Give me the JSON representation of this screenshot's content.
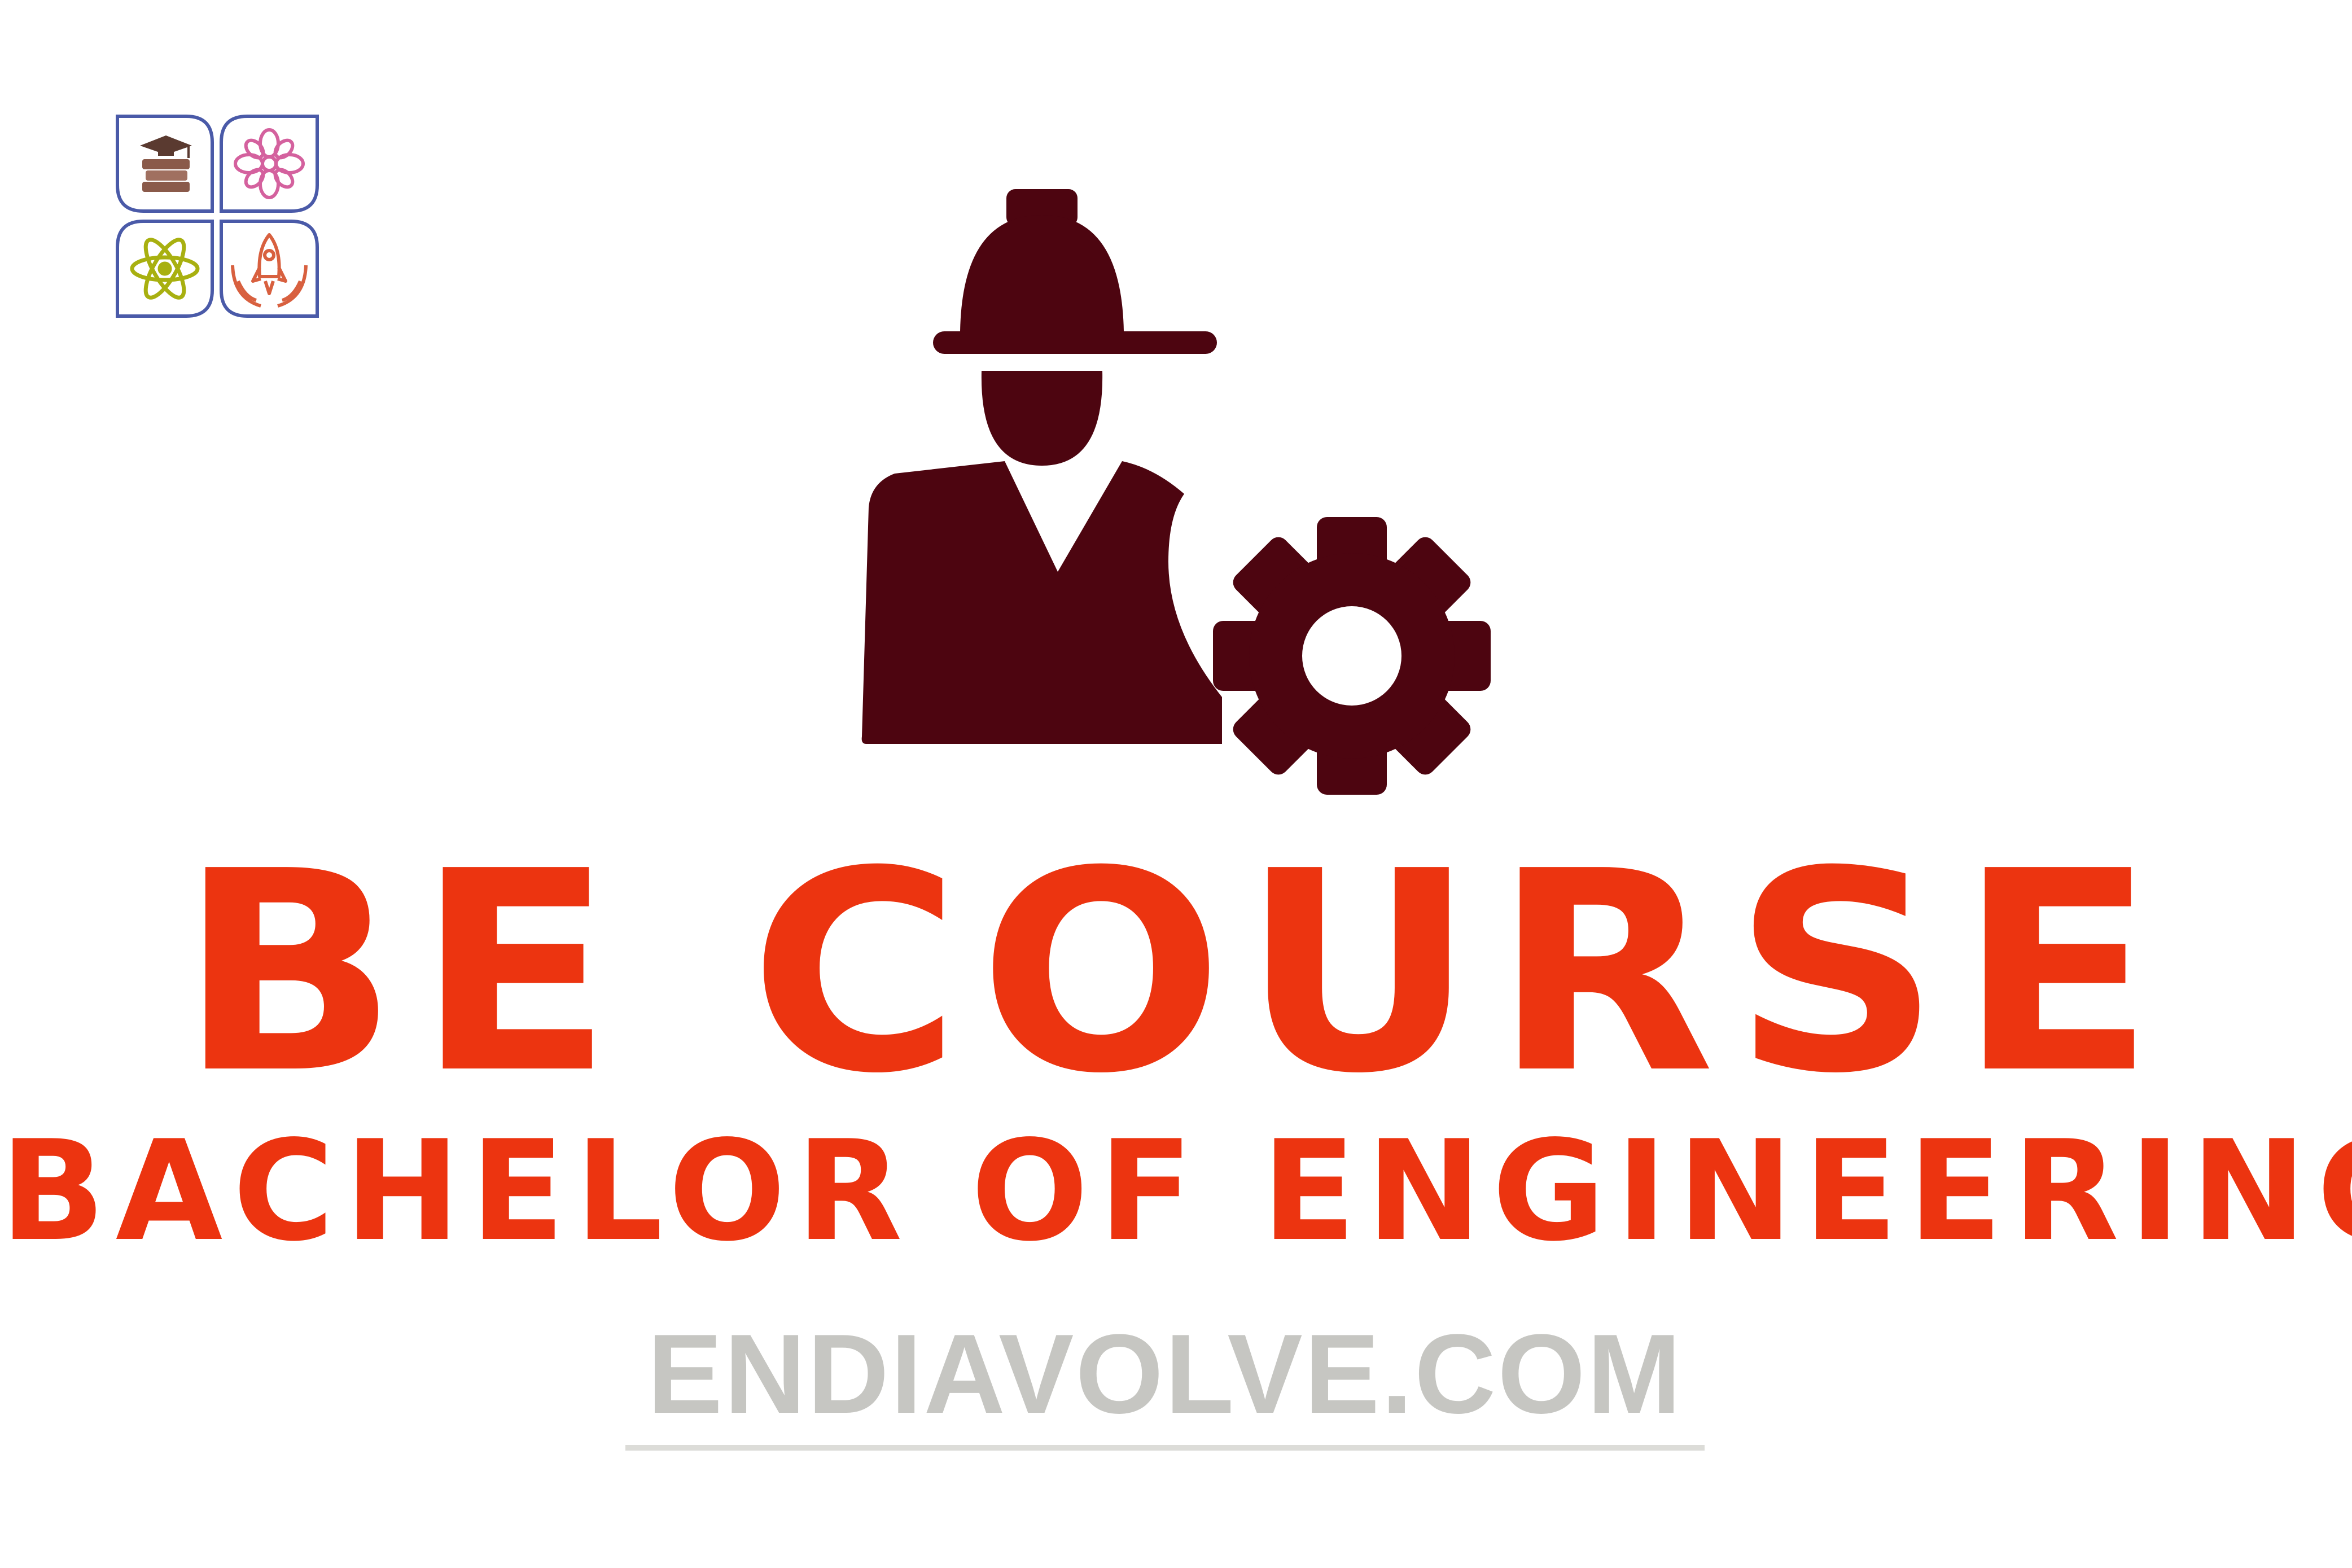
{
  "logo": {
    "quadrants": [
      "books-graduation-cap-icon",
      "flower-icon",
      "atom-icon",
      "rocket-hands-icon"
    ],
    "colors": {
      "frame": "#4a5aa8",
      "books": "#8a5a4a",
      "flower": "#d4619e",
      "atom": "#a8b010",
      "rocket": "#d8603f"
    }
  },
  "hero_icon": "engineer-with-gear-icon",
  "colors": {
    "icon": "#4d0510",
    "title": "#ec3410",
    "watermark": "#c6c6c2",
    "background": "#ffffff"
  },
  "title": "BE COURSE",
  "subtitle": "BACHELOR OF ENGINEERING",
  "website": "ENDIAVOLVE.COM"
}
